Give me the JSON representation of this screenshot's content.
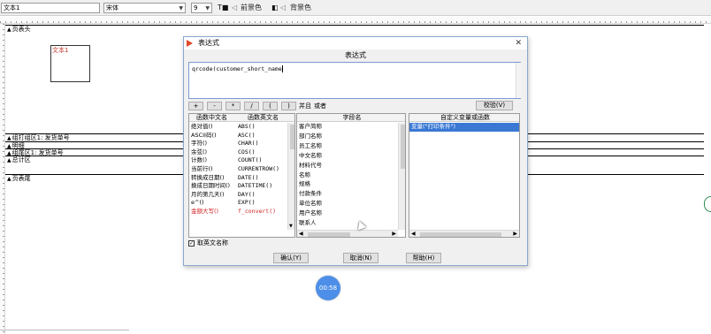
{
  "toolbar": {
    "field_name": "文本1",
    "font": "宋体",
    "size": "9",
    "foreground": "前景色",
    "background": "背景色"
  },
  "designer": {
    "bands": {
      "page_header": "页表头",
      "group_header": "组打组区1: 发货单号",
      "detail": "明细",
      "group_footer": "组尾区1: 发货单号",
      "total": "总计区",
      "page_footer": "页表尾"
    },
    "text_box": "文本1"
  },
  "dialog": {
    "title": "表达式",
    "close": "✕",
    "section_label": "表达式",
    "expression": "qrcode(customer_short_name",
    "operators": [
      "+",
      "-",
      "*",
      "/",
      "(",
      ")"
    ],
    "and_label": "并且",
    "or_label": "或者",
    "verify_button": "校验(V)",
    "functions": {
      "col_cn": "函数中文名",
      "col_en": "函数英文名",
      "rows": [
        {
          "cn": "绝对值()",
          "en": "ABS()",
          "red": false
        },
        {
          "cn": "ASCII码()",
          "en": "ASC()",
          "red": false
        },
        {
          "cn": "字符()",
          "en": "CHAR()",
          "red": false
        },
        {
          "cn": "余弦()",
          "en": "COS()",
          "red": false
        },
        {
          "cn": "计数()",
          "en": "COUNT()",
          "red": false
        },
        {
          "cn": "当前行()",
          "en": "CURRENTROW()",
          "red": false
        },
        {
          "cn": "转换成日期()",
          "en": "DATE()",
          "red": false
        },
        {
          "cn": "换成日期时间()",
          "en": "DATETIME()",
          "red": false
        },
        {
          "cn": "月的第几天()",
          "en": "DAY()",
          "red": false
        },
        {
          "cn": "e^()",
          "en": "EXP()",
          "red": false
        },
        {
          "cn": "金额大写()",
          "en": "f_convert()",
          "red": true
        }
      ]
    },
    "fields": {
      "header": "字段名",
      "rows": [
        "客户简称",
        "部门名称",
        "员工名称",
        "中文名称",
        "材料代号",
        "名称",
        "规格",
        "付款条件",
        "单位名称",
        "用户名称",
        "联系人"
      ]
    },
    "custom": {
      "header": "自定义变量或函数",
      "rows": [
        "变量(\"打印条件\")"
      ]
    },
    "checkbox_label": "取英文名称",
    "checkbox_mark": "✓",
    "confirm_button": "确认(Y)",
    "cancel_button": "取消(N)",
    "help_button": "帮助(H)"
  },
  "timer": "00:58"
}
